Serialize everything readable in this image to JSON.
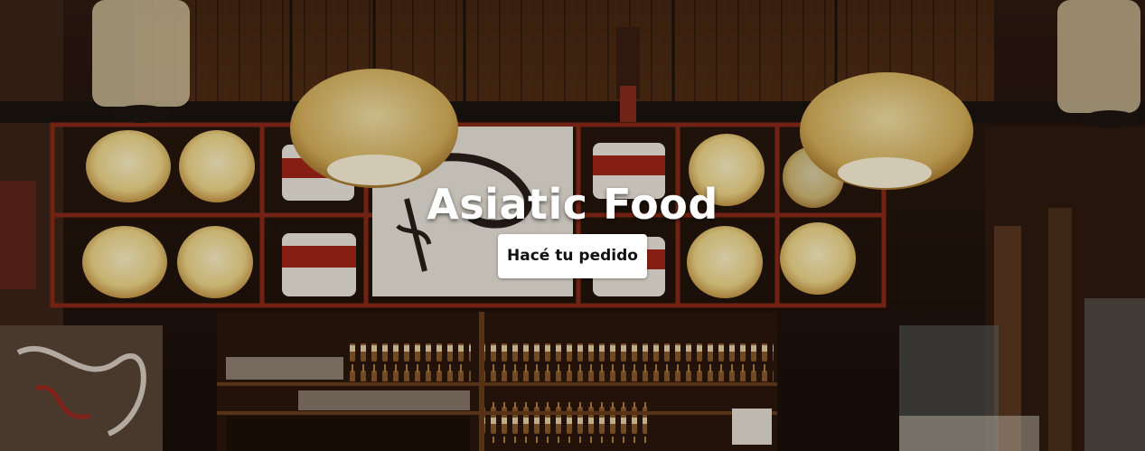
{
  "hero": {
    "title": "Asiatic Food",
    "cta_label": "Hacé tu pedido",
    "cta_background": "#ffffff",
    "cta_text_color": "#111111",
    "title_color": "#ffffff"
  }
}
